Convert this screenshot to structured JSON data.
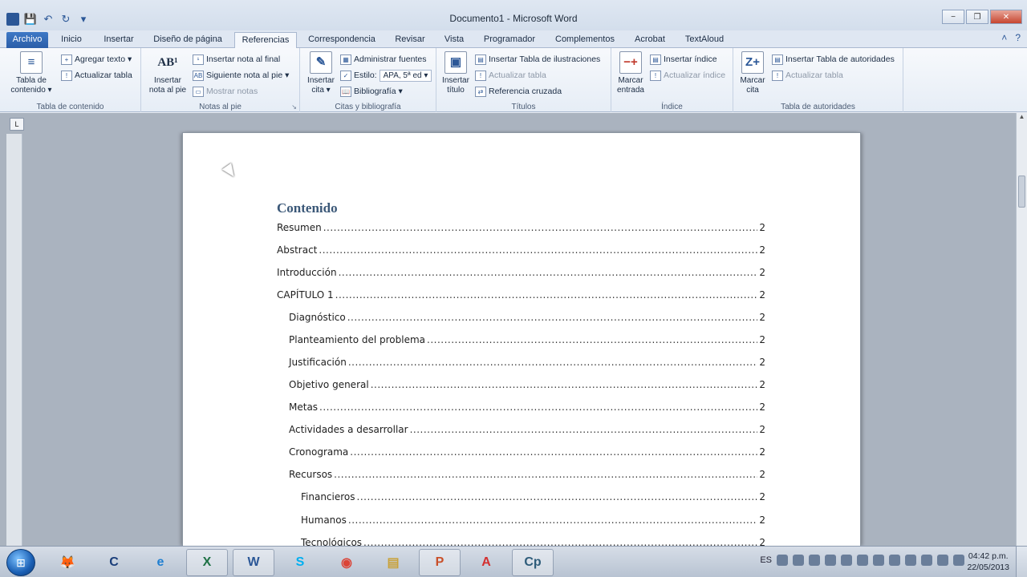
{
  "window": {
    "title": "Documento1 - Microsoft Word",
    "minimize": "−",
    "restore": "❐",
    "close": "✕"
  },
  "quick_access": {
    "app_icon": "W",
    "save": "💾",
    "undo": "↶",
    "redo": "↻",
    "customize": "▾"
  },
  "tabs": [
    {
      "label": "Archivo"
    },
    {
      "label": "Inicio"
    },
    {
      "label": "Insertar"
    },
    {
      "label": "Diseño de página"
    },
    {
      "label": "Referencias"
    },
    {
      "label": "Correspondencia"
    },
    {
      "label": "Revisar"
    },
    {
      "label": "Vista"
    },
    {
      "label": "Programador"
    },
    {
      "label": "Complementos"
    },
    {
      "label": "Acrobat"
    },
    {
      "label": "TextAloud"
    }
  ],
  "ribbon": {
    "toc": {
      "label": "Tabla de contenido",
      "big_button": "Tabla de contenido ▾",
      "add_text": "Agregar texto ▾",
      "update_table": "Actualizar tabla"
    },
    "footnotes": {
      "label": "Notas al pie",
      "big_button": "Insertar nota al pie",
      "big_icon": "AB¹",
      "insert_endnote": "Insertar nota al final",
      "next_footnote": "Siguiente nota al pie ▾",
      "show_notes": "Mostrar notas"
    },
    "citations": {
      "label": "Citas y bibliografía",
      "big_button": "Insertar cita ▾",
      "manage_sources": "Administrar fuentes",
      "style_label": "Estilo:",
      "style_value": "APA, 5ª ed ▾",
      "bibliography": "Bibliografía ▾"
    },
    "captions": {
      "label": "Títulos",
      "big_button": "Insertar título",
      "insert_table_figures": "Insertar Tabla de ilustraciones",
      "update_table": "Actualizar tabla",
      "cross_reference": "Referencia cruzada"
    },
    "index": {
      "label": "Índice",
      "big_button": "Marcar entrada",
      "insert_index": "Insertar índice",
      "update_index": "Actualizar índice"
    },
    "authorities": {
      "label": "Tabla de autoridades",
      "big_button": "Marcar cita",
      "insert_table": "Insertar Tabla de autoridades",
      "update_table": "Actualizar tabla"
    }
  },
  "document": {
    "toc_heading": "Contenido",
    "entries": [
      {
        "text": "Resumen",
        "page": "2"
      },
      {
        "text": "Abstract",
        "page": "2"
      },
      {
        "text": "Introducción",
        "page": "2"
      },
      {
        "text": "CAPÍTULO 1",
        "page": "2"
      },
      {
        "text": "Diagnóstico",
        "page": "2"
      },
      {
        "text": "Planteamiento del problema",
        "page": "2"
      },
      {
        "text": "Justificación",
        "page": "2"
      },
      {
        "text": "Objetivo general",
        "page": "2"
      },
      {
        "text": "Metas",
        "page": "2"
      },
      {
        "text": "Actividades a desarrollar",
        "page": "2"
      },
      {
        "text": "Cronograma",
        "page": "2"
      },
      {
        "text": "Recursos",
        "page": "2"
      },
      {
        "text": "Financieros",
        "page": "2"
      },
      {
        "text": "Humanos",
        "page": "2"
      },
      {
        "text": "Tecnológicos",
        "page": "2"
      }
    ]
  },
  "taskbar": {
    "apps": [
      {
        "name": "firefox",
        "glyph": "🦊"
      },
      {
        "name": "ccleaner",
        "glyph": "C"
      },
      {
        "name": "internet-explorer",
        "glyph": "e"
      },
      {
        "name": "excel",
        "glyph": "X"
      },
      {
        "name": "word",
        "glyph": "W"
      },
      {
        "name": "skype",
        "glyph": "S"
      },
      {
        "name": "chrome",
        "glyph": "◉"
      },
      {
        "name": "explorer",
        "glyph": "▤"
      },
      {
        "name": "powerpoint",
        "glyph": "P"
      },
      {
        "name": "acrobat",
        "glyph": "A"
      },
      {
        "name": "captivate",
        "glyph": "Cp"
      }
    ],
    "language": "ES",
    "time": "04:42 p.m.",
    "date": "22/05/2013"
  }
}
